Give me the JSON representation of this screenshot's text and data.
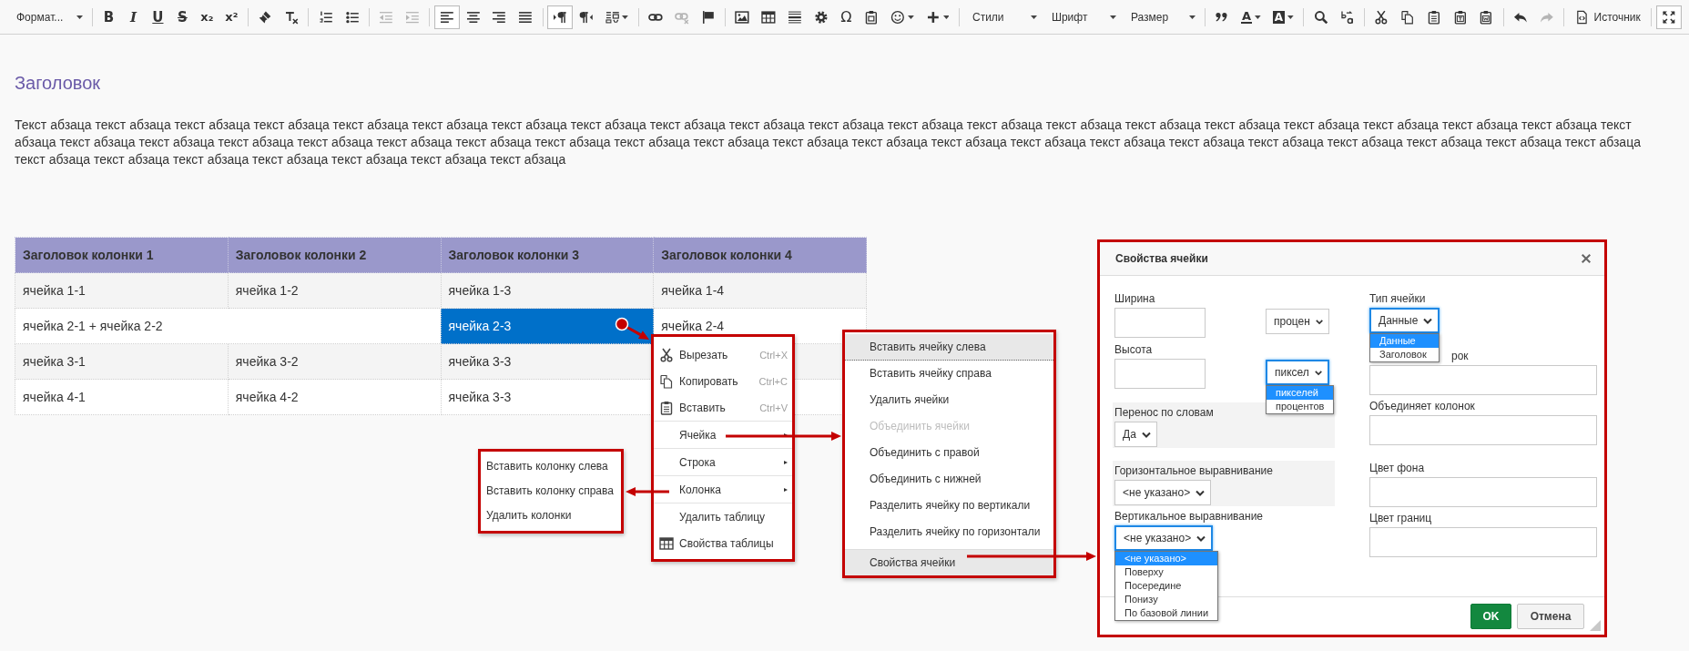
{
  "toolbar": [
    [
      {
        "kind": "dropdown",
        "label": "Формат..."
      }
    ],
    [
      {
        "kind": "glyph",
        "text": "B",
        "on": false,
        "disabled": false
      },
      {
        "kind": "glyph",
        "text": "I",
        "on": false,
        "disabled": false
      },
      {
        "kind": "glyph",
        "text": "U",
        "on": false,
        "disabled": false
      },
      {
        "kind": "glyph",
        "text": "S",
        "on": false,
        "disabled": false
      },
      {
        "kind": "glyph",
        "text": "x₂",
        "on": false,
        "disabled": false
      },
      {
        "kind": "glyph",
        "text": "x²",
        "on": false,
        "disabled": false
      }
    ],
    [
      {
        "kind": "button",
        "on": false,
        "disabled": false
      },
      {
        "kind": "button",
        "on": false,
        "disabled": false
      }
    ],
    [
      {
        "kind": "button",
        "on": false,
        "disabled": false
      },
      {
        "kind": "button",
        "on": false,
        "disabled": false
      }
    ],
    [
      {
        "kind": "button",
        "on": false,
        "disabled": true
      },
      {
        "kind": "button",
        "on": false,
        "disabled": true
      }
    ],
    [
      {
        "kind": "button",
        "on": true,
        "disabled": false
      },
      {
        "kind": "button",
        "on": false,
        "disabled": false
      },
      {
        "kind": "button",
        "on": false,
        "disabled": false
      },
      {
        "kind": "button",
        "on": false,
        "disabled": false
      }
    ],
    [
      {
        "kind": "button",
        "on": true,
        "disabled": false
      },
      {
        "kind": "button",
        "on": false,
        "disabled": false
      },
      {
        "kind": "button",
        "on": false,
        "disabled": false
      }
    ],
    [
      {
        "kind": "button",
        "on": false,
        "disabled": false
      },
      {
        "kind": "button",
        "on": false,
        "disabled": true
      },
      {
        "kind": "button",
        "on": false,
        "disabled": false
      }
    ],
    [
      {
        "kind": "button",
        "on": false,
        "disabled": false
      },
      {
        "kind": "button",
        "on": false,
        "disabled": false
      },
      {
        "kind": "button",
        "on": false,
        "disabled": false
      },
      {
        "kind": "button",
        "on": false,
        "disabled": false
      },
      {
        "kind": "glyph",
        "text": "Ω",
        "on": false,
        "disabled": false
      },
      {
        "kind": "button",
        "on": false,
        "disabled": false
      },
      {
        "kind": "button",
        "on": false,
        "disabled": false
      },
      {
        "kind": "button",
        "on": false,
        "disabled": false
      }
    ],
    [
      {
        "kind": "dropdown",
        "label": "Стили"
      },
      {
        "kind": "dropdown",
        "label": "Шрифт"
      },
      {
        "kind": "dropdown",
        "label": "Размер"
      }
    ],
    [
      {
        "kind": "button",
        "on": false,
        "disabled": false
      },
      {
        "kind": "glyph",
        "text": "A",
        "on": false,
        "disabled": false
      },
      {
        "kind": "glyph",
        "text": "A",
        "on": false,
        "disabled": false
      }
    ],
    [
      {
        "kind": "button",
        "on": false,
        "disabled": false
      },
      {
        "kind": "button",
        "on": false,
        "disabled": false
      }
    ],
    [
      {
        "kind": "button",
        "on": false,
        "disabled": false
      },
      {
        "kind": "button",
        "on": false,
        "disabled": false
      },
      {
        "kind": "button",
        "on": false,
        "disabled": false
      },
      {
        "kind": "button",
        "on": false,
        "disabled": false
      },
      {
        "kind": "button",
        "on": false,
        "disabled": false
      }
    ],
    [
      {
        "kind": "button",
        "on": false,
        "disabled": false
      },
      {
        "kind": "button",
        "on": false,
        "disabled": true
      }
    ],
    [
      {
        "kind": "labeled",
        "label": "Источник"
      }
    ],
    [
      {
        "kind": "button",
        "on": true,
        "disabled": false
      }
    ]
  ],
  "document": {
    "heading": "Заголовок",
    "paragraph": "Текст абзаца текст абзаца текст абзаца текст абзаца текст абзаца текст абзаца текст абзаца текст абзаца текст абзаца текст абзаца текст абзаца текст абзаца текст абзаца текст абзаца текст абзаца текст абзаца текст абзаца текст абзаца текст абзаца текст абзаца текст абзаца текст абзаца текст абзаца текст абзаца текст абзаца текст абзаца текст абзаца текст абзаца текст абзаца текст абзаца текст абзаца текст абзаца текст абзаца текст абзаца текст абзаца текст абзаца текст абзаца текст абзаца текст абзаца текст абзаца текст абзаца текст абзаца текст абзаца текст абзаца текст абзаца текст абзаца текст абзаца текст абзаца",
    "table": {
      "columns": [
        "Заголовок колонки 1",
        "Заголовок колонки 2",
        "Заголовок колонки 3",
        "Заголовок колонки 4"
      ],
      "rows": [
        {
          "cells": [
            {
              "text": "ячейка 1-1",
              "selected": false
            },
            {
              "text": "ячейка 1-2",
              "selected": false
            },
            {
              "text": "ячейка 1-3",
              "selected": false
            },
            {
              "text": "ячейка 1-4",
              "selected": false
            }
          ]
        },
        {
          "cells": [
            {
              "text": "ячейка 2-1 + ячейка 2-2",
              "colspan": 2,
              "selected": false
            },
            {
              "text": "ячейка 2-3",
              "selected": true
            },
            {
              "text": "ячейка 2-4",
              "selected": false
            }
          ]
        },
        {
          "cells": [
            {
              "text": "ячейка 3-1",
              "selected": false
            },
            {
              "text": "ячейка 3-2",
              "selected": false
            },
            {
              "text": "ячейка 3-3",
              "selected": false
            }
          ]
        },
        {
          "cells": [
            {
              "text": "ячейка 4-1",
              "selected": false
            },
            {
              "text": "ячейка 4-2",
              "selected": false
            },
            {
              "text": "ячейка 3-3",
              "selected": false
            }
          ]
        }
      ]
    }
  },
  "context_menu": {
    "groups": [
      [
        {
          "label": "Вырезать",
          "shortcut": "Ctrl+X",
          "submenu": false
        },
        {
          "label": "Копировать",
          "shortcut": "Ctrl+C",
          "submenu": false
        },
        {
          "label": "Вставить",
          "shortcut": "Ctrl+V",
          "submenu": false
        }
      ],
      [
        {
          "label": "Ячейка",
          "submenu": true
        }
      ],
      [
        {
          "label": "Строка",
          "submenu": true
        }
      ],
      [
        {
          "label": "Колонка",
          "submenu": true
        }
      ],
      [
        {
          "label": "Удалить таблицу",
          "submenu": false
        },
        {
          "label": "Свойства таблицы",
          "submenu": false
        }
      ]
    ]
  },
  "column_submenu": {
    "items": [
      {
        "label": "Вставить колонку слева"
      },
      {
        "label": "Вставить колонку справа"
      },
      {
        "label": "Удалить колонки"
      }
    ]
  },
  "cell_submenu": {
    "groups": [
      [
        {
          "label": "Вставить ячейку слева",
          "disabled": false,
          "highlighted": true
        },
        {
          "label": "Вставить ячейку справа",
          "disabled": false,
          "highlighted": false
        },
        {
          "label": "Удалить ячейки",
          "disabled": false,
          "highlighted": false
        },
        {
          "label": "Объединить ячейки",
          "disabled": true,
          "highlighted": false
        },
        {
          "label": "Объединить с правой",
          "disabled": false,
          "highlighted": false
        },
        {
          "label": "Объединить с нижней",
          "disabled": false,
          "highlighted": false
        },
        {
          "label": "Разделить ячейку по вертикали",
          "disabled": false,
          "highlighted": false
        },
        {
          "label": "Разделить ячейку по горизонтали",
          "disabled": false,
          "highlighted": false
        }
      ],
      [
        {
          "label": "Свойства ячейки",
          "disabled": false,
          "highlighted": true
        }
      ]
    ]
  },
  "dialog": {
    "title": "Свойства ячейки",
    "left": [
      {
        "kind": "size",
        "label": "Ширина",
        "shaded": false,
        "unit": {
          "value": "процен",
          "focused": false
        }
      },
      {
        "kind": "size",
        "label": "Высота",
        "shaded": false,
        "unit": {
          "value": "пиксел",
          "focused": true,
          "options": [
            {
              "label": "пикселей",
              "selected": true
            },
            {
              "label": "процентов",
              "selected": false
            }
          ]
        }
      },
      {
        "kind": "select",
        "label": "Перенос по словам",
        "shaded": true,
        "select": {
          "value": "Да",
          "focused": false
        }
      },
      {
        "kind": "select",
        "label": "Горизонтальное выравнивание",
        "shaded": true,
        "select": {
          "value": "<не указано>",
          "focused": false
        }
      },
      {
        "kind": "select",
        "label": "Вертикальное выравнивание",
        "shaded": false,
        "select": {
          "value": "<не указано>",
          "focused": true,
          "options": [
            {
              "label": "<не указано>",
              "selected": true
            },
            {
              "label": "Поверху",
              "selected": false
            },
            {
              "label": "Посередине",
              "selected": false
            },
            {
              "label": "Понизу",
              "selected": false
            },
            {
              "label": "По базовой линии",
              "selected": false
            }
          ]
        }
      }
    ],
    "right": [
      {
        "kind": "select",
        "label": "Тип ячейки",
        "shaded": false,
        "select": {
          "value": "Данные",
          "focused": true,
          "options": [
            {
              "label": "Данные",
              "selected": true
            },
            {
              "label": "Заголовок",
              "selected": false
            }
          ]
        }
      },
      {
        "kind": "text",
        "label": "рок",
        "shaded": false,
        "covered": true
      },
      {
        "kind": "text",
        "label": "Объединяет колонок",
        "shaded": false,
        "covered": false
      },
      {
        "kind": "text",
        "label": "Цвет фона",
        "shaded": false,
        "covered": false
      },
      {
        "kind": "text",
        "label": "Цвет границ",
        "shaded": false,
        "covered": false
      }
    ],
    "buttons": [
      {
        "label": "OK",
        "kind": "primary"
      },
      {
        "label": "Отмена",
        "kind": "secondary"
      }
    ]
  }
}
